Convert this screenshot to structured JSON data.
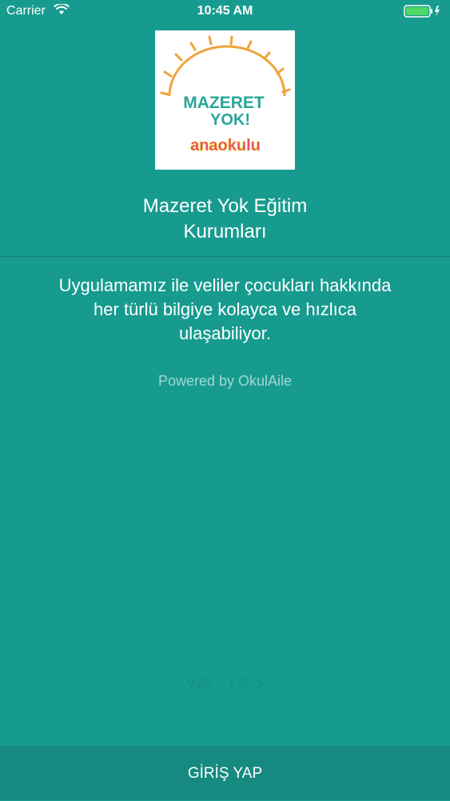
{
  "status_bar": {
    "carrier": "Carrier",
    "time": "10:45 AM"
  },
  "logo": {
    "line1": "MAZERET",
    "line2": "YOK!",
    "line3": "anaokulu",
    "colors": {
      "sun": "#f0a33a",
      "text": "#2aa59a"
    }
  },
  "org": {
    "name_line1": "Mazeret Yok Eğitim",
    "name_line2": "Kurumları"
  },
  "description": {
    "line1": "Uygulamamız ile veliler çocukları hakkında",
    "line2": "her türlü bilgiye kolayca ve hızlıca",
    "line3": "ulaşabiliyor."
  },
  "powered_by": "Powered by OkulAile",
  "version": "v25 - 1.2.5",
  "login_button_label": "GİRİŞ YAP",
  "colors": {
    "background": "#179b8f",
    "button": "#168a80"
  }
}
